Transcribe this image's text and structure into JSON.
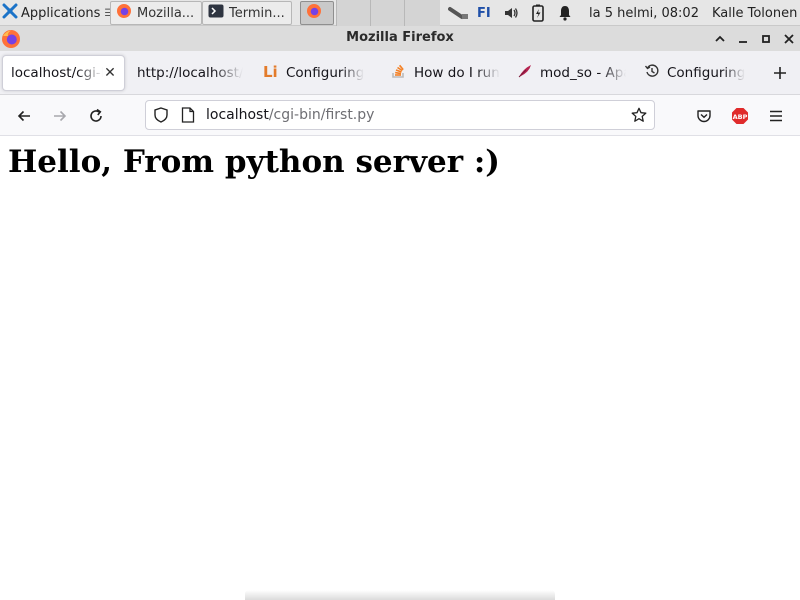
{
  "panel": {
    "applications_label": "Applications",
    "tasks": [
      {
        "label": "Mozilla...",
        "icon": "firefox-icon"
      },
      {
        "label": "Termin...",
        "icon": "terminal-icon"
      },
      {
        "label": "",
        "icon": "firefox-icon"
      }
    ],
    "keyboard_layout": "FI",
    "clock": "la  5 helmi, 08:02",
    "user": "Kalle Tolonen"
  },
  "window": {
    "title": "Mozilla Firefox",
    "buttons": [
      "collapse",
      "minimize",
      "maximize",
      "close"
    ]
  },
  "tabs": [
    {
      "label": "localhost/cgi-bin/first.py",
      "icon": "",
      "selected": true
    },
    {
      "label": "http://localhost/",
      "icon": "",
      "selected": false
    },
    {
      "label": "Configuring",
      "icon": "linode-li-icon",
      "selected": false
    },
    {
      "label": "How do I run",
      "icon": "stackoverflow-icon",
      "selected": false
    },
    {
      "label": "mod_so - Apache",
      "icon": "apache-feather-icon",
      "selected": false
    },
    {
      "label": "Configuring",
      "icon": "history-icon",
      "selected": false
    }
  ],
  "navbar": {
    "url_host": "localhost",
    "url_path": "/cgi-bin/first.py"
  },
  "page": {
    "heading": "Hello, From python server :)"
  },
  "colors": {
    "panel_bg": "#e6e6e6",
    "titlebar_bg": "#dcdcdc",
    "tabstrip_bg": "#f0f0f4",
    "abp_red": "#e02b2b",
    "firefox_orange": "#ff7139"
  }
}
